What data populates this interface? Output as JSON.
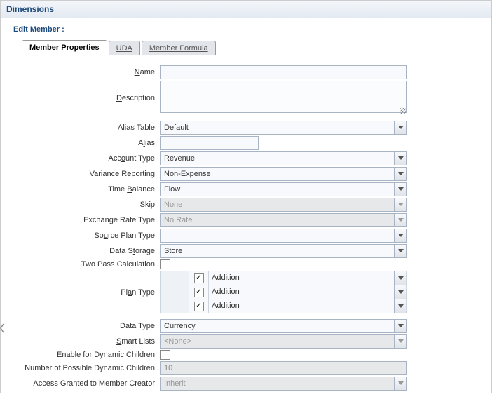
{
  "header": {
    "title": "Dimensions"
  },
  "subheader": {
    "prefix": "Edit Member :",
    "member": ""
  },
  "tabs": {
    "member_properties": "Member Properties",
    "uda": "UDA",
    "member_formula": "Member Formula"
  },
  "labels": {
    "name": "Name",
    "description": "Description",
    "alias_table": "Alias Table",
    "alias": "Alias",
    "account_type": "Account Type",
    "variance_reporting": "Variance Reporting",
    "time_balance": "Time Balance",
    "skip": "Skip",
    "exchange_rate_type": "Exchange Rate Type",
    "source_plan_type": "Source Plan Type",
    "data_storage": "Data Storage",
    "two_pass": "Two Pass Calculation",
    "plan_type": "Plan Type",
    "data_type": "Data Type",
    "smart_lists": "Smart Lists",
    "enable_dynamic": "Enable for Dynamic Children",
    "num_dynamic": "Number of Possible Dynamic Children",
    "access_granted": "Access Granted to Member Creator"
  },
  "values": {
    "name": "",
    "description": "",
    "alias_table": "Default",
    "alias": "",
    "account_type": "Revenue",
    "variance_reporting": "Non-Expense",
    "time_balance": "Flow",
    "skip": "None",
    "exchange_rate_type": "No Rate",
    "source_plan_type": "",
    "data_storage": "Store",
    "two_pass": false,
    "plan_rows": [
      {
        "checked": true,
        "value": "Addition"
      },
      {
        "checked": true,
        "value": "Addition"
      },
      {
        "checked": true,
        "value": "Addition"
      }
    ],
    "data_type": "Currency",
    "smart_lists": "<None>",
    "enable_dynamic": false,
    "num_dynamic": "10",
    "access_granted": "Inherit"
  }
}
